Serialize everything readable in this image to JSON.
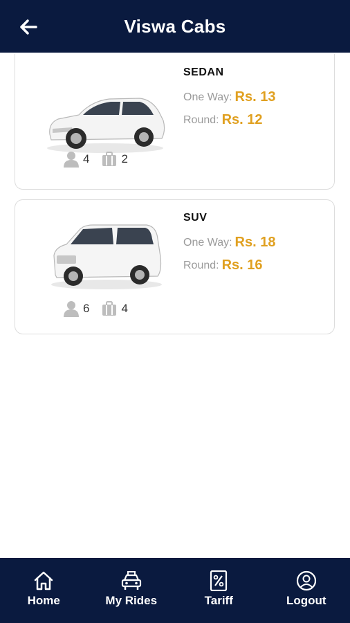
{
  "header": {
    "title": "Viswa Cabs",
    "back_icon": "arrow-left-icon"
  },
  "cabs": [
    {
      "type": "SEDAN",
      "one_way_label": "One Way:",
      "one_way_price": "Rs. 13",
      "round_label": "Round:",
      "round_price": "Rs. 12",
      "seats": "4",
      "bags": "2"
    },
    {
      "type": "SUV",
      "one_way_label": "One Way:",
      "one_way_price": "Rs. 18",
      "round_label": "Round:",
      "round_price": "Rs. 16",
      "seats": "6",
      "bags": "4"
    }
  ],
  "nav": [
    {
      "label": "Home",
      "icon": "home-icon"
    },
    {
      "label": "My Rides",
      "icon": "taxi-icon"
    },
    {
      "label": "Tariff",
      "icon": "percent-icon"
    },
    {
      "label": "Logout",
      "icon": "user-circle-icon"
    }
  ],
  "colors": {
    "primary": "#0a1a3f",
    "price": "#e0a020"
  }
}
